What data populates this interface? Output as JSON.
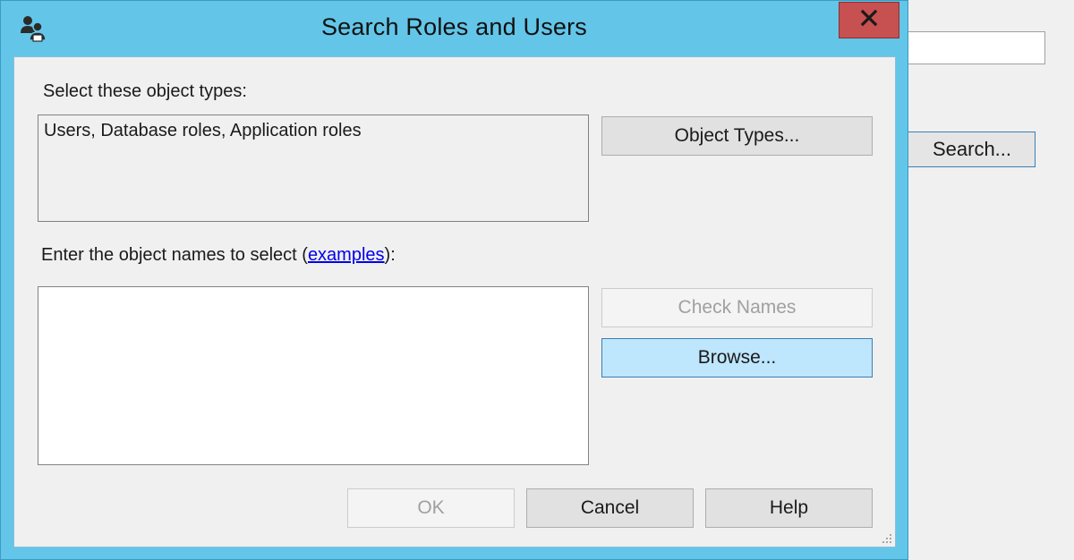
{
  "background": {
    "search_button_label": "Search..."
  },
  "dialog": {
    "title": "Search Roles and Users",
    "close_glyph": "x",
    "object_types_label": "Select these object types:",
    "object_types_value": "Users, Database roles, Application roles",
    "object_types_button": "Object Types...",
    "names_label_prefix": "Enter the object names to select (",
    "names_label_link": "examples",
    "names_label_suffix": "):",
    "names_value": "",
    "check_names_button": "Check Names",
    "browse_button": "Browse...",
    "ok_button": "OK",
    "cancel_button": "Cancel",
    "help_button": "Help"
  },
  "colors": {
    "titlebar": "#63c6e8",
    "close": "#c75050",
    "focused_button": "#bee6fd",
    "link": "#0000ee"
  },
  "icons": {
    "app": "users-icon",
    "close": "close-icon",
    "grip": "resize-grip-icon"
  }
}
